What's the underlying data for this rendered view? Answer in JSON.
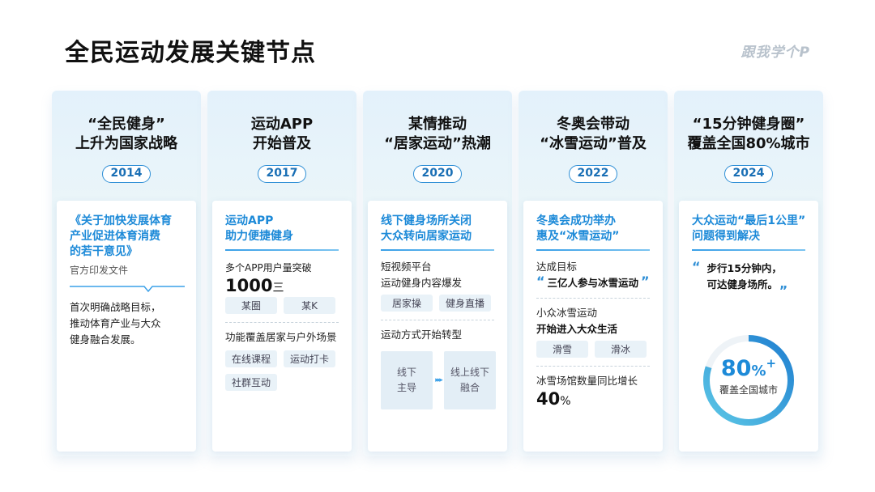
{
  "page": {
    "title": "全民运动发展关键节点",
    "brand": "跟我学个P"
  },
  "accent": "#1d8ad8",
  "columns": [
    {
      "head": [
        "“全民健身”",
        "上升为国家战略"
      ],
      "year": "2014",
      "card": {
        "title": [
          "《关于加快发展体育",
          "产业促进体育消费",
          "的若干意见》"
        ],
        "subtitle": "官方印发文件",
        "body": [
          "首次明确战略目标，",
          "推动体育产业与大众",
          "健身融合发展。"
        ]
      }
    },
    {
      "head": [
        "运动APP",
        "开始普及"
      ],
      "year": "2017",
      "card": {
        "title": [
          "运动APP",
          "助力便捷健身"
        ],
        "stat_label": "多个APP用户量突破",
        "stat_value": "1000",
        "stat_unit": "三",
        "tags1": [
          "某圈",
          "某K"
        ],
        "line2": "功能覆盖居家与户外场景",
        "tags2": [
          "在线课程",
          "运动打卡",
          "社群互动"
        ]
      }
    },
    {
      "head": [
        "某情推动",
        "“居家运动”热潮"
      ],
      "year": "2020",
      "card": {
        "title": [
          "线下健身场所关闭",
          "大众转向居家运动"
        ],
        "line1": [
          "短视频平台",
          "运动健身内容爆发"
        ],
        "tags1": [
          "居家操",
          "健身直播"
        ],
        "line2": "运动方式开始转型",
        "flow_from": [
          "线下",
          "主导"
        ],
        "flow_arrow": "▸▸▸",
        "flow_to": [
          "线上线下",
          "融合"
        ]
      }
    },
    {
      "head": [
        "冬奥会带动",
        "“冰雪运动”普及"
      ],
      "year": "2022",
      "card": {
        "title": [
          "冬奥会成功举办",
          "惠及“冰雪运动”"
        ],
        "goal_label": "达成目标",
        "goal_open": "“",
        "goal_text": "三亿人参与冰雪运动",
        "goal_close": "”",
        "line2a": "小众冰雪运动",
        "line2b": "开始进入大众生活",
        "tags": [
          "滑雪",
          "滑冰"
        ],
        "line3": "冰雪场馆数量同比增长",
        "stat_value": "40",
        "stat_unit": "%"
      }
    },
    {
      "head": [
        "“15分钟健身圈”",
        "覆盖全国80%城市"
      ],
      "year": "2024",
      "card": {
        "title": [
          "大众运动“最后1公里”",
          "问题得到解决"
        ],
        "quote_open": "“",
        "quote": [
          "步行15分钟内，",
          "可达健身场所。"
        ],
        "quote_close": "„",
        "ring_value": "80",
        "ring_suffix": "%",
        "ring_plus": "+",
        "ring_fraction": 0.8,
        "ring_label": "覆盖全国城市"
      }
    }
  ]
}
